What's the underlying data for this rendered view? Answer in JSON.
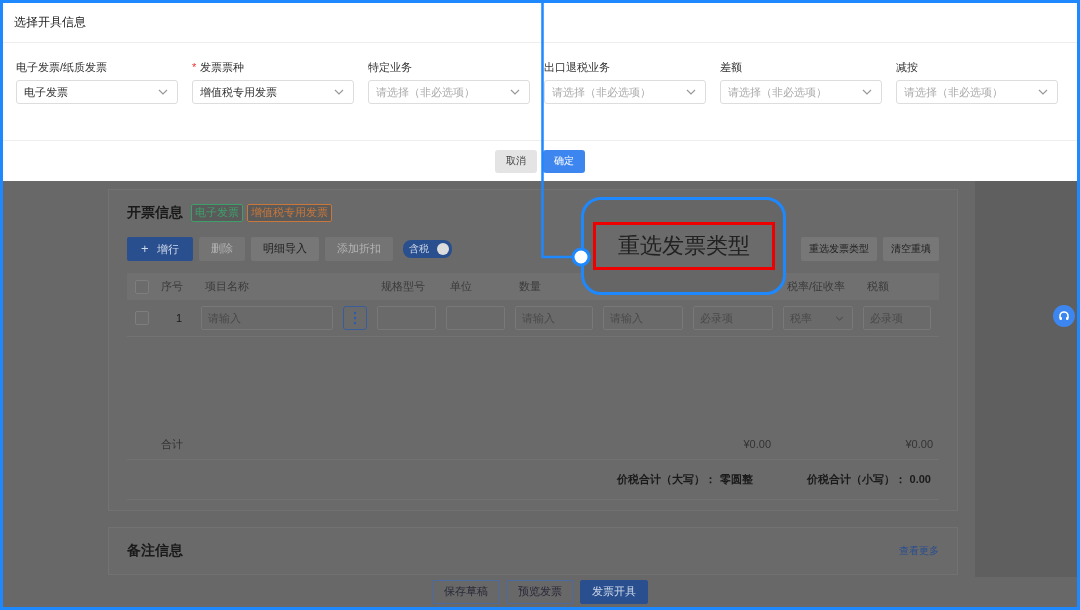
{
  "dialog": {
    "title": "选择开具信息",
    "fields": [
      {
        "label": "电子发票/纸质发票",
        "value": "电子发票"
      },
      {
        "label": "发票票种",
        "marker": "*",
        "value": "增值税专用发票"
      },
      {
        "label": "特定业务",
        "placeholder": "请选择（非必选项）"
      },
      {
        "label": "出口退税业务",
        "placeholder": "请选择（非必选项）"
      },
      {
        "label": "差额",
        "placeholder": "请选择（非必选项）"
      },
      {
        "label": "减按",
        "placeholder": "请选择（非必选项）"
      }
    ],
    "buttons": [
      {
        "label": "取消",
        "kind": "secondary"
      },
      {
        "label": "确定",
        "kind": "primary"
      }
    ]
  },
  "invoice_section": {
    "title": "开票信息",
    "tags": [
      {
        "label": "电子发票",
        "color": "#3f9f6a"
      },
      {
        "label": "增值税专用发票",
        "color": "#c9773a"
      }
    ],
    "toolbar": [
      {
        "label": "增行",
        "icon": "+",
        "kind": "primary",
        "disabled": false
      },
      {
        "label": "删除",
        "kind": "plain",
        "disabled": true
      },
      {
        "label": "明细导入",
        "kind": "plain",
        "disabled": false
      },
      {
        "label": "添加折扣",
        "kind": "plain",
        "disabled": true
      }
    ],
    "tax_toggle": {
      "label": "含税",
      "on": true
    },
    "right_buttons": [
      "重选发票类型",
      "清空重填"
    ],
    "table": {
      "select_all_checked": false,
      "columns": [
        "序号",
        "项目名称",
        "",
        "规格型号",
        "单位",
        "数量",
        "",
        "",
        "税率/征收率",
        "税额"
      ],
      "rows": [
        {
          "checked": false,
          "cells": [
            {
              "kind": "index",
              "value": "1"
            },
            {
              "kind": "input",
              "placeholder": "请输入"
            },
            {
              "kind": "more"
            },
            {
              "kind": "input"
            },
            {
              "kind": "input"
            },
            {
              "kind": "input",
              "placeholder": "请输入"
            },
            {
              "kind": "input",
              "placeholder": "请输入"
            },
            {
              "kind": "input",
              "placeholder": "必录项"
            },
            {
              "kind": "select",
              "placeholder": "税率"
            },
            {
              "kind": "input",
              "placeholder": "必录项"
            }
          ]
        }
      ],
      "total": {
        "label": "合计",
        "amount": "¥0.00",
        "tax": "¥0.00"
      },
      "summary": [
        {
          "label": "价税合计（大写）：",
          "value": "零圆整"
        },
        {
          "label": "价税合计（小写）：",
          "value": "0.00"
        }
      ]
    }
  },
  "remarks_section": {
    "title": "备注信息",
    "link": "查看更多"
  },
  "footer": {
    "buttons": [
      {
        "label": "保存草稿",
        "kind": "outline"
      },
      {
        "label": "预览发票",
        "kind": "outline"
      },
      {
        "label": "发票开具",
        "kind": "primary"
      }
    ]
  },
  "callout": {
    "text": "重选发票类型"
  }
}
